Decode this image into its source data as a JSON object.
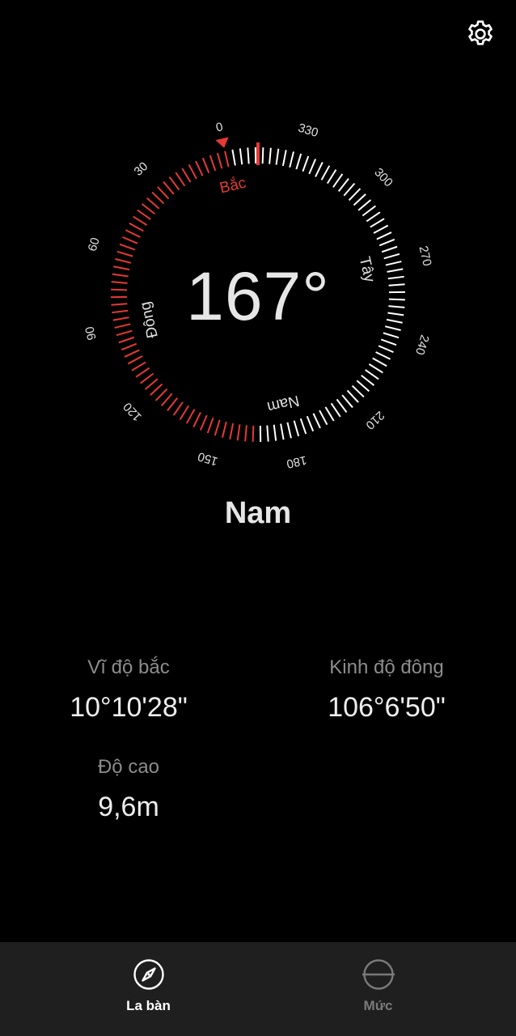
{
  "header": {
    "settings_icon": "gear-icon"
  },
  "compass": {
    "heading_deg": 167,
    "heading_text": "167°",
    "direction_text": "Nam",
    "degree_labels": [
      "0",
      "30",
      "60",
      "90",
      "120",
      "150",
      "180",
      "210",
      "240",
      "270",
      "300",
      "330"
    ],
    "cardinals": {
      "north": "Bắc",
      "east": "Đông",
      "south": "Nam",
      "west": "Tây"
    },
    "colors": {
      "accent": "#e53935",
      "tick": "#ffffff",
      "label": "#e0e0e0"
    }
  },
  "info": {
    "latitude_label": "Vĩ độ bắc",
    "latitude_value": "10°10'28\"",
    "longitude_label": "Kinh độ đông",
    "longitude_value": "106°6'50\"",
    "altitude_label": "Độ cao",
    "altitude_value": "9,6m"
  },
  "nav": {
    "items": [
      {
        "label": "La bàn",
        "icon": "compass-icon",
        "active": true
      },
      {
        "label": "Mức",
        "icon": "level-icon",
        "active": false
      }
    ],
    "active_color": "#ffffff",
    "inactive_color": "#7a7a7a"
  }
}
